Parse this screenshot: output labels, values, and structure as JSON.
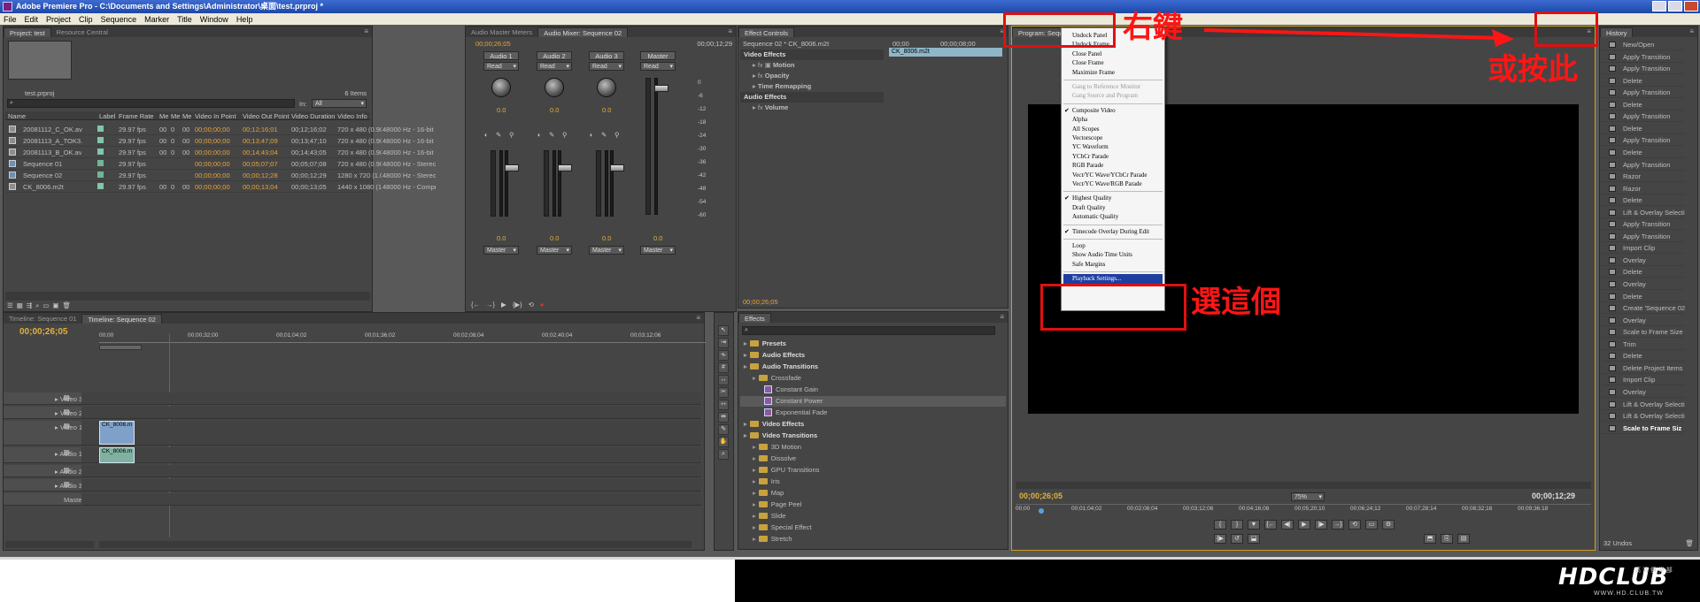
{
  "window": {
    "title": "Adobe Premiere Pro - C:\\Documents and Settings\\Administrator\\桌面\\test.prproj *"
  },
  "menu": [
    "File",
    "Edit",
    "Project",
    "Clip",
    "Sequence",
    "Marker",
    "Title",
    "Window",
    "Help"
  ],
  "project": {
    "tabs": [
      "Project: test",
      "Resource Central"
    ],
    "filename": "test.prproj",
    "items_count": "6 Items",
    "in_label": "In:",
    "in_value": "All",
    "columns": [
      "Name",
      "Label",
      "Frame Rate",
      "Me",
      "Me",
      "Me",
      "Video In Point",
      "Video Out Point",
      "Video Duration",
      "Video Info",
      "Audio Info"
    ],
    "rows": [
      [
        "20081112_C_OK.av",
        "",
        "29.97 fps",
        "00",
        "0",
        "00",
        "00;00;00;00",
        "00;12;16;01",
        "00;12;16;02",
        "720 x 480 (0.9091",
        "48000 Hz - 16-bit -"
      ],
      [
        "20081113_A_TOK3.",
        "",
        "29.97 fps",
        "00",
        "0",
        "00",
        "00;00;00;00",
        "00;13;47;09",
        "00;13;47;10",
        "720 x 480 (0.9091",
        "48000 Hz - 16-bit -"
      ],
      [
        "20081113_B_OK.av",
        "",
        "29.97 fps",
        "00",
        "0",
        "00",
        "00;00;00;00",
        "00;14;43;04",
        "00;14;43;05",
        "720 x 480 (0.9091",
        "48000 Hz - 16-bit -"
      ],
      [
        "Sequence 01",
        "",
        "29.97 fps",
        "",
        "",
        "",
        "00;00;00;00",
        "00;05;07;07",
        "00;05;07;08",
        "720 x 480 (0.9091",
        "48000 Hz - Stereo"
      ],
      [
        "Sequence 02",
        "",
        "29.97 fps",
        "",
        "",
        "",
        "00;00;00;00",
        "00;00;12;28",
        "00;00;12;29",
        "1280 x 720 (1.0)",
        "48000 Hz - Stereo"
      ],
      [
        "CK_8006.m2t",
        "",
        "29.97 fps",
        "00",
        "0",
        "00",
        "00;00;00;00",
        "00;00;13;04",
        "00;00;13;05",
        "1440 x 1080 (1.33",
        "48000 Hz - Compr"
      ]
    ]
  },
  "mixer": {
    "tabs": [
      "Audio Master Meters",
      "Audio Mixer: Sequence 02"
    ],
    "timecode_left": "00;00;26;05",
    "timecode_right": "00;00;12;29",
    "channels": [
      "Audio 1",
      "Audio 2",
      "Audio 3",
      "Master"
    ],
    "read_label": "Read",
    "values": [
      "0.0",
      "0.0",
      "0.0",
      "0.0"
    ],
    "fader_values": [
      "0.0",
      "0.0",
      "0.0",
      "0.0"
    ],
    "output": "Master",
    "scale": [
      "0",
      "-6",
      "-12",
      "-18",
      "-24",
      "-30",
      "-36",
      "-42",
      "-48",
      "-54",
      "-60"
    ]
  },
  "effect_controls": {
    "tab": "Effect Controls",
    "sequence": "Sequence 02 * CK_8006.m2t",
    "ruler_start": "00;00",
    "ruler_mid": "00;00;08;00",
    "clip_label": "CK_8006.m2t",
    "video_effects": "Video Effects",
    "motion": "Motion",
    "opacity": "Opacity",
    "time_remapping": "Time Remapping",
    "audio_effects": "Audio Effects",
    "volume": "Volume",
    "timecode": "00;00;26;05"
  },
  "effects": {
    "tab": "Effects",
    "tree": [
      {
        "label": "Presets",
        "level": 0,
        "type": "folder"
      },
      {
        "label": "Audio Effects",
        "level": 0,
        "type": "folder"
      },
      {
        "label": "Audio Transitions",
        "level": 0,
        "type": "folder"
      },
      {
        "label": "Crossfade",
        "level": 1,
        "type": "folder"
      },
      {
        "label": "Constant Gain",
        "level": 2,
        "type": "item"
      },
      {
        "label": "Constant Power",
        "level": 2,
        "type": "item"
      },
      {
        "label": "Exponential Fade",
        "level": 2,
        "type": "item"
      },
      {
        "label": "Video Effects",
        "level": 0,
        "type": "folder"
      },
      {
        "label": "Video Transitions",
        "level": 0,
        "type": "folder"
      },
      {
        "label": "3D Motion",
        "level": 1,
        "type": "folder"
      },
      {
        "label": "Dissolve",
        "level": 1,
        "type": "folder"
      },
      {
        "label": "GPU Transitions",
        "level": 1,
        "type": "folder"
      },
      {
        "label": "Iris",
        "level": 1,
        "type": "folder"
      },
      {
        "label": "Map",
        "level": 1,
        "type": "folder"
      },
      {
        "label": "Page Peel",
        "level": 1,
        "type": "folder"
      },
      {
        "label": "Slide",
        "level": 1,
        "type": "folder"
      },
      {
        "label": "Special Effect",
        "level": 1,
        "type": "folder"
      },
      {
        "label": "Stretch",
        "level": 1,
        "type": "folder"
      }
    ]
  },
  "program": {
    "tab": "Program: Sequence 02",
    "timecode_left": "00;00;26;05",
    "zoom": "75%",
    "timecode_right": "00;00;12;29",
    "ruler": [
      "00;00",
      "00;01;04;02",
      "00;02;08;04",
      "00;03;12;06",
      "00;04;16;08",
      "00;05;20;10",
      "00;06;24;12",
      "00;07;28;14",
      "00;08;32;16",
      "00;09;36;18"
    ]
  },
  "context_menu": [
    {
      "label": "Undock Panel",
      "state": "normal"
    },
    {
      "label": "Undock Frame",
      "state": "normal"
    },
    {
      "label": "Close Panel",
      "state": "normal"
    },
    {
      "label": "Close Frame",
      "state": "normal"
    },
    {
      "label": "Maximize Frame",
      "state": "normal"
    },
    {
      "label": "sep"
    },
    {
      "label": "Gang to Reference Monitor",
      "state": "disabled"
    },
    {
      "label": "Gang Source and Program",
      "state": "disabled"
    },
    {
      "label": "sep"
    },
    {
      "label": "Composite Video",
      "state": "checked"
    },
    {
      "label": "Alpha",
      "state": "normal"
    },
    {
      "label": "All Scopes",
      "state": "normal"
    },
    {
      "label": "Vectorscope",
      "state": "normal"
    },
    {
      "label": "YC Waveform",
      "state": "normal"
    },
    {
      "label": "YCbCr Parade",
      "state": "normal"
    },
    {
      "label": "RGB Parade",
      "state": "normal"
    },
    {
      "label": "Vect/YC Wave/YCbCr Parade",
      "state": "normal"
    },
    {
      "label": "Vect/YC Wave/RGB Parade",
      "state": "normal"
    },
    {
      "label": "sep"
    },
    {
      "label": "Highest Quality",
      "state": "checked"
    },
    {
      "label": "Draft Quality",
      "state": "normal"
    },
    {
      "label": "Automatic Quality",
      "state": "normal"
    },
    {
      "label": "sep"
    },
    {
      "label": "Timecode Overlay During Edit",
      "state": "checked"
    },
    {
      "label": "sep"
    },
    {
      "label": "Loop",
      "state": "normal"
    },
    {
      "label": "Show Audio Time Units",
      "state": "normal"
    },
    {
      "label": "Safe Margins",
      "state": "normal"
    },
    {
      "label": "sep"
    },
    {
      "label": "Playback Settings...",
      "state": "highlighted"
    }
  ],
  "history": {
    "tab": "History",
    "items": [
      "New/Open",
      "Apply Transition",
      "Apply Transition",
      "Delete",
      "Apply Transition",
      "Delete",
      "Apply Transition",
      "Delete",
      "Apply Transition",
      "Delete",
      "Apply Transition",
      "Razor",
      "Razor",
      "Delete",
      "Lift & Overlay Selectio",
      "Apply Transition",
      "Apply Transition",
      "Import Clip",
      "Overlay",
      "Delete",
      "Overlay",
      "Delete",
      "Create 'Sequence 02'",
      "Overlay",
      "Scale to Frame Size",
      "Trim",
      "Delete",
      "Delete Project Items",
      "Import Clip",
      "Overlay",
      "Lift & Overlay Selectio",
      "Lift & Overlay Selectio",
      "Scale to Frame Siz"
    ],
    "undos": "32 Undos"
  },
  "timeline": {
    "tabs": [
      "Timeline: Sequence 01",
      "Timeline: Sequence 02"
    ],
    "timecode": "00;00;26;05",
    "ruler": [
      "00;00",
      "00;00;32;00",
      "00;01;04;02",
      "00;01;36;02",
      "00;02;08;04",
      "00;02;40;04",
      "00;03;12;06"
    ],
    "tracks": [
      "Video 3",
      "Video 2",
      "Video 1",
      "Audio 1",
      "Audio 2",
      "Audio 3",
      "Master"
    ],
    "clip_label": "CK_8006.m"
  },
  "annotations": {
    "right_click": "右鍵",
    "or_click": "或按此",
    "choose_this": "選這個"
  },
  "watermark": {
    "logo": "HDCLUB",
    "sub": "高 清 俱 樂 部",
    "url": "WWW.HD.CLUB.TW"
  }
}
